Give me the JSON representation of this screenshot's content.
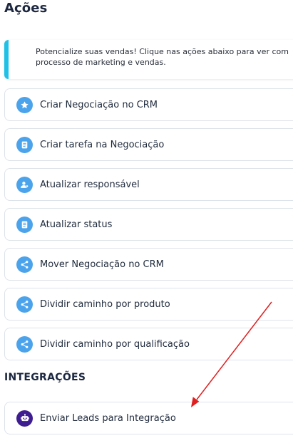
{
  "page": {
    "title": "Ações"
  },
  "banner": {
    "line1": "Potencialize suas vendas! Clique nas ações abaixo para ver com",
    "line2": "processo de marketing e vendas.",
    "accent_color": "#1fc1e6"
  },
  "actions": [
    {
      "label": "Criar Negociação no CRM",
      "icon": "star-icon"
    },
    {
      "label": "Criar tarefa na Negociação",
      "icon": "document-icon"
    },
    {
      "label": "Atualizar responsável",
      "icon": "user-icon"
    },
    {
      "label": "Atualizar status",
      "icon": "document-icon"
    },
    {
      "label": "Mover Negociação no CRM",
      "icon": "share-icon"
    },
    {
      "label": "Dividir caminho por produto",
      "icon": "share-icon"
    },
    {
      "label": "Dividir caminho por qualificação",
      "icon": "share-icon"
    }
  ],
  "integrations": {
    "section_title": "INTEGRAÇÕES",
    "items": [
      {
        "label": "Enviar Leads para Integração",
        "icon": "robot-icon"
      }
    ]
  },
  "colors": {
    "icon_blue": "#4ba3ec",
    "icon_purple": "#3d1d8f",
    "annotation_arrow": "#e02020"
  }
}
